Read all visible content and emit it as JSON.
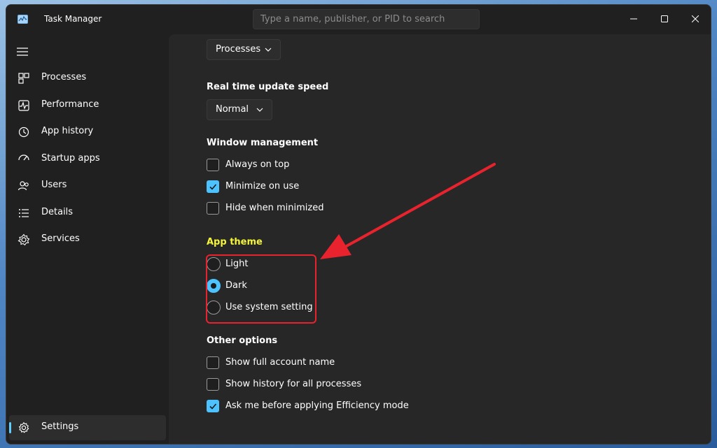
{
  "window": {
    "title": "Task Manager"
  },
  "search": {
    "placeholder": "Type a name, publisher, or PID to search"
  },
  "window_controls": {
    "minimize_icon": "minimize-icon",
    "maximize_icon": "maximize-icon",
    "close_icon": "close-icon"
  },
  "sidebar": {
    "items": [
      {
        "label": "Processes",
        "icon": "processes-icon"
      },
      {
        "label": "Performance",
        "icon": "performance-icon"
      },
      {
        "label": "App history",
        "icon": "history-icon"
      },
      {
        "label": "Startup apps",
        "icon": "startup-icon"
      },
      {
        "label": "Users",
        "icon": "users-icon"
      },
      {
        "label": "Details",
        "icon": "details-icon"
      },
      {
        "label": "Services",
        "icon": "services-icon"
      }
    ],
    "settings": {
      "label": "Settings",
      "icon": "gear-icon",
      "active": true
    }
  },
  "settings": {
    "default_page": {
      "value": "Processes"
    },
    "update_speed": {
      "title": "Real time update speed",
      "value": "Normal"
    },
    "window_management": {
      "title": "Window management",
      "options": [
        {
          "label": "Always on top",
          "checked": false
        },
        {
          "label": "Minimize on use",
          "checked": true
        },
        {
          "label": "Hide when minimized",
          "checked": false
        }
      ]
    },
    "app_theme": {
      "title": "App theme",
      "options": [
        {
          "label": "Light",
          "selected": false
        },
        {
          "label": "Dark",
          "selected": true
        },
        {
          "label": "Use system setting",
          "selected": false
        }
      ]
    },
    "other_options": {
      "title": "Other options",
      "options": [
        {
          "label": "Show full account name",
          "checked": false
        },
        {
          "label": "Show history for all processes",
          "checked": false
        },
        {
          "label": "Ask me before applying Efficiency mode",
          "checked": true
        }
      ]
    }
  },
  "colors": {
    "accent": "#4cc2ff",
    "window_bg": "#202020",
    "content_bg": "#272727",
    "highlight_text": "#f4f43a",
    "annotation_red": "#e8232d"
  }
}
